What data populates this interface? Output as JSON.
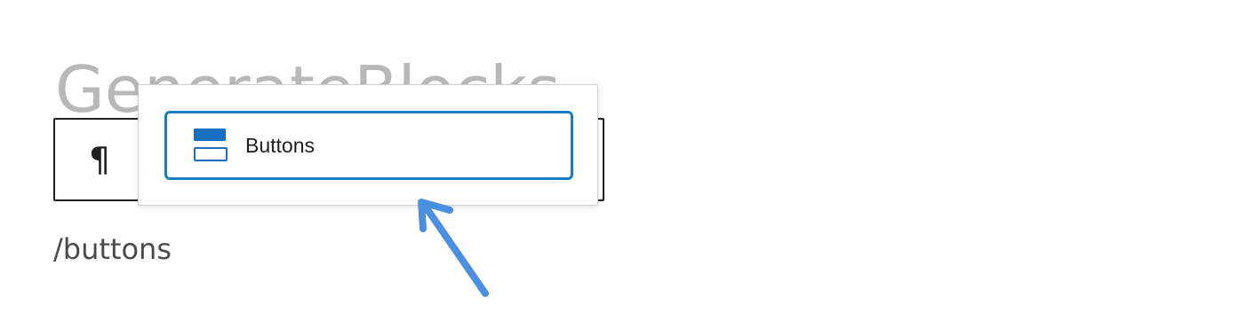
{
  "editor": {
    "title": "GenerateBlocks",
    "slash_command": "/buttons"
  },
  "toolbar": {
    "paragraph_symbol": "¶"
  },
  "autocomplete": {
    "options": [
      {
        "label": "Buttons",
        "icon": "buttons-icon"
      }
    ]
  },
  "colors": {
    "accent": "#1a7cbe",
    "icon": "#1a6fc0",
    "annotation_arrow": "#4a8fe0"
  }
}
